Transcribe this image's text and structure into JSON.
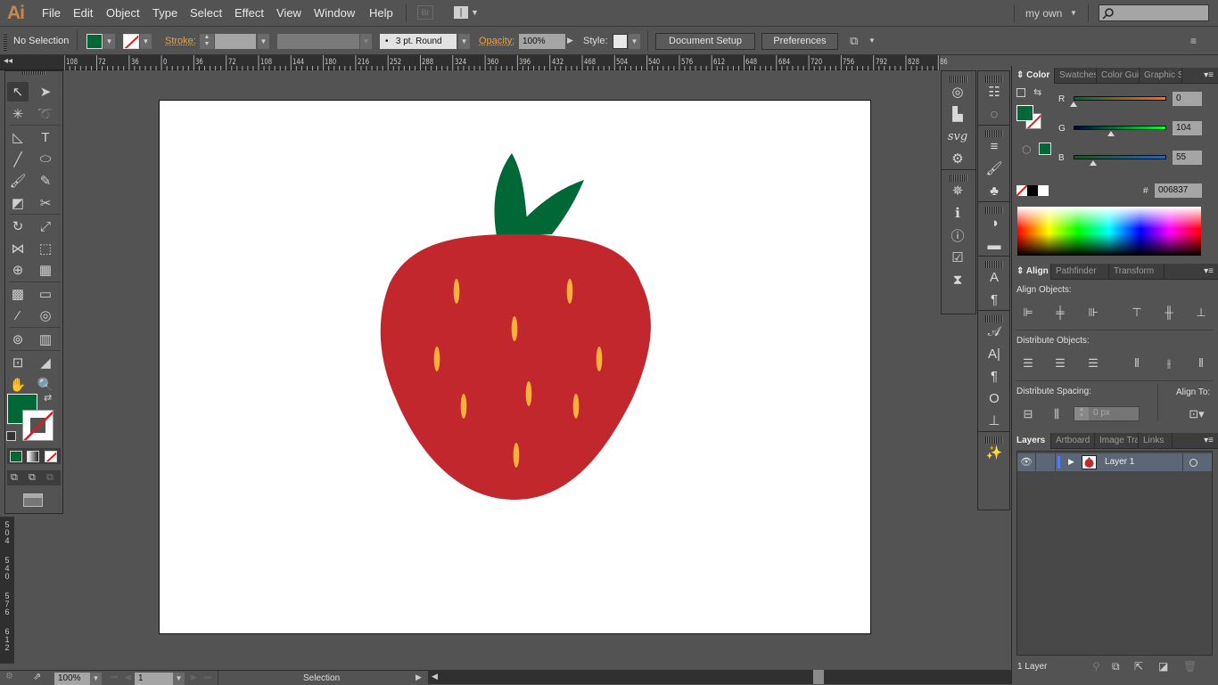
{
  "app": {
    "logo": "Ai"
  },
  "menu": {
    "items": [
      "File",
      "Edit",
      "Object",
      "Type",
      "Select",
      "Effect",
      "View",
      "Window",
      "Help"
    ],
    "bridge_label": "Br",
    "workspace": "my own"
  },
  "control_bar": {
    "selection_status": "No Selection",
    "fill_color": "#006837",
    "stroke_label": "Stroke:",
    "brush_profile": "3 pt. Round",
    "brush_dot": "•",
    "opacity_label": "Opacity:",
    "opacity_value": "100%",
    "style_label": "Style:",
    "document_setup": "Document Setup",
    "preferences": "Preferences"
  },
  "rulers": {
    "horizontal": [
      "108",
      "72",
      "36",
      "0",
      "36",
      "72",
      "108",
      "144",
      "180",
      "216",
      "252",
      "288",
      "324",
      "360",
      "396",
      "432",
      "468",
      "504",
      "540",
      "576",
      "612",
      "648",
      "684",
      "720",
      "756",
      "792",
      "828",
      "86"
    ],
    "vertical": [
      "504",
      "540",
      "576",
      "612"
    ]
  },
  "tools": [
    {
      "name": "selection-tool",
      "glyph": "↖"
    },
    {
      "name": "direct-selection-tool",
      "glyph": "➤"
    },
    {
      "name": "magic-wand-tool",
      "glyph": "✳"
    },
    {
      "name": "lasso-tool",
      "glyph": "➰"
    },
    {
      "name": "pen-tool",
      "glyph": "◺"
    },
    {
      "name": "type-tool",
      "glyph": "T"
    },
    {
      "name": "line-segment-tool",
      "glyph": "╱"
    },
    {
      "name": "ellipse-tool",
      "glyph": "⬭"
    },
    {
      "name": "paintbrush-tool",
      "glyph": "🖌"
    },
    {
      "name": "pencil-tool",
      "glyph": "✎"
    },
    {
      "name": "shaper-tool",
      "glyph": "◩"
    },
    {
      "name": "scissors-tool",
      "glyph": "✂"
    },
    {
      "name": "rotate-tool",
      "glyph": "↻"
    },
    {
      "name": "scale-tool",
      "glyph": "⤢"
    },
    {
      "name": "width-tool",
      "glyph": "⋈"
    },
    {
      "name": "free-transform-tool",
      "glyph": "⬚"
    },
    {
      "name": "shape-builder-tool",
      "glyph": "⊕"
    },
    {
      "name": "perspective-grid-tool",
      "glyph": "▦"
    },
    {
      "name": "mesh-tool",
      "glyph": "▩"
    },
    {
      "name": "gradient-tool",
      "glyph": "▭"
    },
    {
      "name": "eyedropper-tool",
      "glyph": "⁄"
    },
    {
      "name": "blend-tool",
      "glyph": "◎"
    },
    {
      "name": "symbol-sprayer-tool",
      "glyph": "⊚"
    },
    {
      "name": "column-graph-tool",
      "glyph": "▥"
    },
    {
      "name": "artboard-tool",
      "glyph": "⊡"
    },
    {
      "name": "slice-tool",
      "glyph": "◢"
    },
    {
      "name": "hand-tool",
      "glyph": "✋"
    },
    {
      "name": "zoom-tool",
      "glyph": "🔍"
    }
  ],
  "toolbox": {
    "fill_color": "#006837",
    "screen_mode_glyph": "▭"
  },
  "dock1": [
    {
      "name": "appearance-icon",
      "glyph": "◎"
    },
    {
      "name": "artboards-icon",
      "glyph": "▙"
    },
    {
      "name": "svg-interactivity-icon",
      "glyph": "svg"
    },
    {
      "name": "actions-icon",
      "glyph": "⚙"
    },
    {
      "name": "navigator-icon",
      "glyph": "✵"
    },
    {
      "name": "info-icon",
      "glyph": "ℹ"
    },
    {
      "name": "document-info-icon",
      "glyph": "ⓘ"
    },
    {
      "name": "attributes-icon",
      "glyph": "☑"
    },
    {
      "name": "flattener-preview-icon",
      "glyph": "⧗"
    }
  ],
  "dock2": [
    {
      "name": "transparency-settings-icon",
      "glyph": "☷"
    },
    {
      "name": "stroke-icon",
      "glyph": "◌"
    },
    {
      "name": "brushes-icon",
      "glyph": "≡"
    },
    {
      "name": "graphic-styles-brush-icon",
      "glyph": "🖌"
    },
    {
      "name": "symbols-icon",
      "glyph": "♣"
    },
    {
      "name": "transparency-icon",
      "glyph": "◑"
    },
    {
      "name": "gradient-icon",
      "glyph": "▬"
    },
    {
      "name": "character-styles-icon",
      "glyph": "A"
    },
    {
      "name": "paragraph-styles-icon",
      "glyph": "¶"
    },
    {
      "name": "character-icon",
      "glyph": "𝒜"
    },
    {
      "name": "text-cursor-icon",
      "glyph": "A|"
    },
    {
      "name": "paragraph-icon",
      "glyph": "¶"
    },
    {
      "name": "opentype-icon",
      "glyph": "O"
    },
    {
      "name": "tabs-icon",
      "glyph": "⊥"
    },
    {
      "name": "image-trace-icon",
      "glyph": "✨"
    }
  ],
  "color_panel": {
    "tabs": [
      "Color",
      "Swatches",
      "Color Guide",
      "Graphic Styles"
    ],
    "r_label": "R",
    "g_label": "G",
    "b_label": "B",
    "r": "0",
    "g": "104",
    "b": "55",
    "r_pct": 0,
    "g_pct": 40.8,
    "b_pct": 21.6,
    "hex_label": "#",
    "hex": "006837"
  },
  "align_panel": {
    "tabs": [
      "Align",
      "Pathfinder",
      "Transform"
    ],
    "align_objects_label": "Align Objects:",
    "distribute_objects_label": "Distribute Objects:",
    "distribute_spacing_label": "Distribute Spacing:",
    "align_to_label": "Align To:",
    "spacing_value": "0 px"
  },
  "layers_panel": {
    "tabs": [
      "Layers",
      "Artboard",
      "Image Trace",
      "Links"
    ],
    "layers": [
      {
        "name": "Layer 1",
        "color": "#4f7cff"
      }
    ],
    "count": "1 Layer"
  },
  "status_bar": {
    "zoom": "100%",
    "artboard": "1",
    "tool": "Selection"
  },
  "artwork": {
    "body_color": "#c1272d",
    "leaf_color": "#006837",
    "seed_color": "#fbb03b"
  }
}
